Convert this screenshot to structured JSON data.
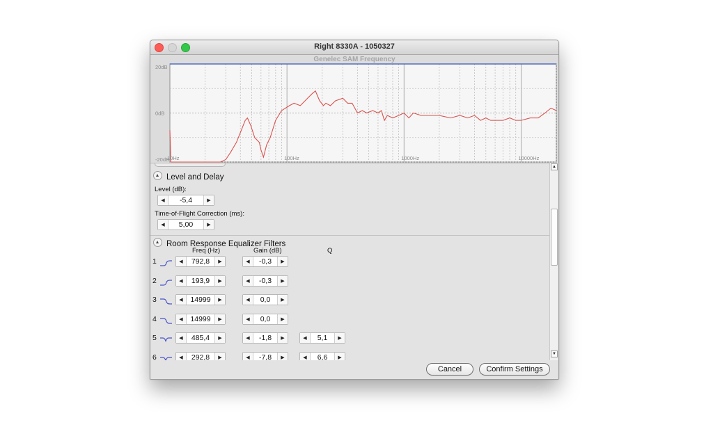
{
  "window": {
    "title": "Right 8330A - 1050327"
  },
  "chart_data": {
    "type": "line",
    "title": "Genelec SAM Frequency",
    "x_scale": "log",
    "xlim": [
      10,
      20000
    ],
    "ylim": [
      -20,
      20
    ],
    "x_ticks": [
      "10Hz",
      "100Hz",
      "1000Hz",
      "10000Hz"
    ],
    "y_ticks": [
      "20dB",
      "0dB",
      "-20dB"
    ],
    "grid": true,
    "series": [
      {
        "color": "#d9534f",
        "x": [
          10,
          10.2,
          15,
          27,
          30,
          33,
          37,
          40,
          44,
          46,
          49,
          53,
          58,
          60,
          63,
          67,
          72,
          80,
          90,
          105,
          115,
          130,
          150,
          165,
          175,
          190,
          205,
          215,
          235,
          260,
          300,
          330,
          360,
          380,
          400,
          440,
          480,
          540,
          600,
          640,
          680,
          720,
          800,
          900,
          1000,
          1100,
          1200,
          1400,
          1600,
          1800,
          2000,
          2500,
          3000,
          3500,
          4000,
          4500,
          5000,
          5500,
          6000,
          7000,
          8000,
          9000,
          10000,
          12000,
          14000,
          16000,
          18000,
          20000
        ],
        "y": [
          -7,
          -20,
          -20,
          -20,
          -19,
          -16,
          -12,
          -8,
          -3,
          -2,
          -5,
          -10,
          -12,
          -15,
          -18,
          -13,
          -10,
          -3,
          1,
          3,
          4,
          3,
          6,
          8,
          9,
          5,
          3,
          4,
          3,
          5,
          6,
          4,
          4,
          2,
          0,
          1,
          0,
          1,
          0,
          1,
          -3,
          -1,
          -2,
          -1,
          0,
          -2,
          0,
          -1,
          -1,
          -1,
          -1,
          -2,
          -1,
          -2,
          -1,
          -3,
          -2,
          -3,
          -3,
          -3,
          -2,
          -3,
          -3,
          -2,
          -2,
          0,
          2,
          1
        ]
      }
    ]
  },
  "level_delay": {
    "header": "Level and Delay",
    "level_label": "Level (dB):",
    "level_value": "-5,4",
    "tof_label": "Time-of-Flight Correction (ms):",
    "tof_value": "5,00"
  },
  "eq": {
    "header": "Room Response Equalizer Filters",
    "col_freq": "Freq (Hz)",
    "col_gain": "Gain (dB)",
    "col_q": "Q",
    "rows": [
      {
        "num": "1",
        "type_icon": "low-shelf-icon",
        "freq": "792,8",
        "gain": "-0,3",
        "q": ""
      },
      {
        "num": "2",
        "type_icon": "low-shelf-icon",
        "freq": "193,9",
        "gain": "-0,3",
        "q": ""
      },
      {
        "num": "3",
        "type_icon": "high-shelf-icon",
        "freq": "14999",
        "gain": "0,0",
        "q": ""
      },
      {
        "num": "4",
        "type_icon": "high-shelf-icon",
        "freq": "14999",
        "gain": "0,0",
        "q": ""
      },
      {
        "num": "5",
        "type_icon": "notch-icon",
        "freq": "485,4",
        "gain": "-1,8",
        "q": "5,1"
      },
      {
        "num": "6",
        "type_icon": "notch-icon",
        "freq": "292,8",
        "gain": "-7,8",
        "q": "6,6"
      }
    ]
  },
  "buttons": {
    "cancel": "Cancel",
    "confirm": "Confirm Settings"
  }
}
